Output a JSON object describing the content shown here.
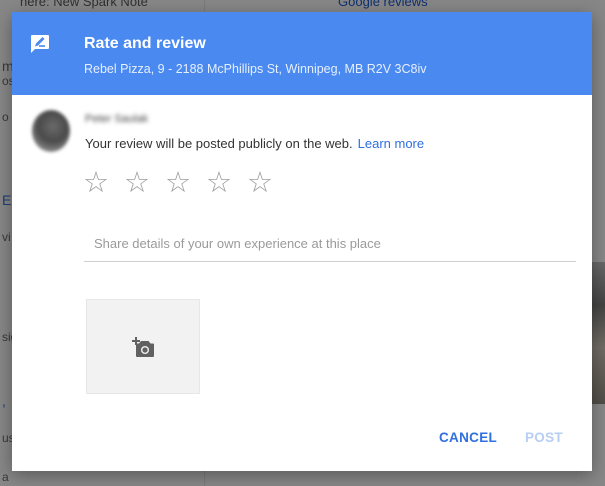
{
  "background": {
    "top_left_text": "here: New Spark Note",
    "top_right_text": "Google reviews",
    "side_fragments": [
      "m",
      "ost",
      "o",
      "E",
      "vi",
      "sig",
      ",",
      "ust",
      "a"
    ]
  },
  "dialog": {
    "icon": "rate-review-icon",
    "title": "Rate and review",
    "subtitle": "Rebel Pizza, 9 - 2188 McPhillips St, Winnipeg, MB R2V 3C8iv",
    "user_name": "Peter Saulak",
    "notice": "Your review will be posted publicly on the web.",
    "learn_more": "Learn more",
    "star_glyph": "☆",
    "stars": [
      "1",
      "2",
      "3",
      "4",
      "5"
    ],
    "review_placeholder": "Share details of your own experience at this place",
    "add_photo_icon": "add-a-photo-icon",
    "cancel_label": "CANCEL",
    "post_label": "POST"
  },
  "colors": {
    "header": "#4a89ef",
    "accent": "#2f6fe0",
    "post_disabled": "#b7cdf3",
    "star": "#9e9e9e"
  }
}
